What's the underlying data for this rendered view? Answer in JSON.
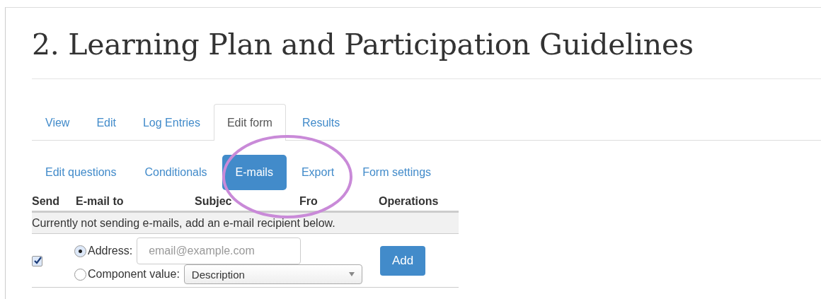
{
  "title": "2. Learning Plan and Participation Guidelines",
  "tabs": [
    {
      "label": "View",
      "selected": false
    },
    {
      "label": "Edit",
      "selected": false
    },
    {
      "label": "Log Entries",
      "selected": false
    },
    {
      "label": "Edit form",
      "selected": true
    },
    {
      "label": "Results",
      "selected": false
    }
  ],
  "subtabs": [
    {
      "label": "Edit questions",
      "selected": false
    },
    {
      "label": "Conditionals",
      "selected": false
    },
    {
      "label": "E-mails",
      "selected": true
    },
    {
      "label": "Export",
      "selected": false
    },
    {
      "label": "Form settings",
      "selected": false
    }
  ],
  "table": {
    "columns": [
      "Send",
      "E-mail to",
      "Subjec",
      "Fro",
      "Operations"
    ],
    "message": "Currently not sending e-mails, add an e-mail recipient below.",
    "new_row": {
      "send_checked": true,
      "options": [
        {
          "kind": "address",
          "label": "Address:",
          "selected": true,
          "placeholder": "email@example.com"
        },
        {
          "kind": "component",
          "label": "Component value:",
          "selected": false,
          "value": "Description"
        }
      ],
      "button": "Add"
    }
  },
  "annotation": {
    "kind": "ellipse"
  }
}
